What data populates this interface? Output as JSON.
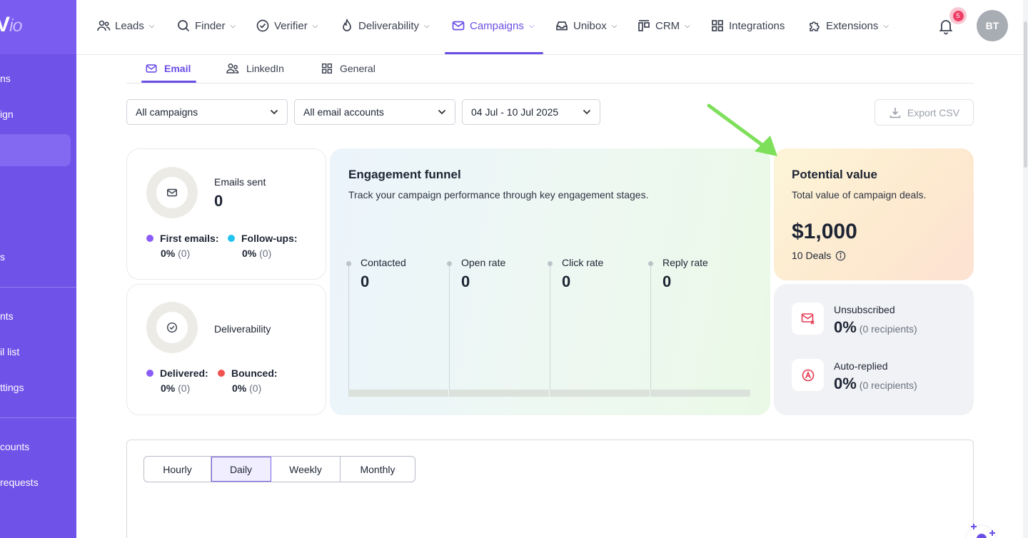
{
  "sidebar": {
    "logo_main": "V",
    "logo_suffix": "io",
    "items": [
      "ns",
      "ign",
      "s",
      "nts",
      "il list",
      "ttings",
      "counts",
      "requests"
    ]
  },
  "nav": {
    "items": [
      {
        "label": "Leads",
        "icon": "users-icon"
      },
      {
        "label": "Finder",
        "icon": "search-icon"
      },
      {
        "label": "Verifier",
        "icon": "check-circle-icon"
      },
      {
        "label": "Deliverability",
        "icon": "flame-icon"
      },
      {
        "label": "Campaigns",
        "icon": "mail-icon",
        "active": true
      },
      {
        "label": "Unibox",
        "icon": "inbox-icon"
      },
      {
        "label": "CRM",
        "icon": "crm-icon"
      },
      {
        "label": "Integrations",
        "icon": "grid-icon"
      },
      {
        "label": "Extensions",
        "icon": "puzzle-icon"
      }
    ],
    "notification_count": "5",
    "avatar_initials": "BT"
  },
  "subtabs": {
    "email": "Email",
    "linkedin": "LinkedIn",
    "general": "General"
  },
  "filters": {
    "campaigns": "All campaigns",
    "accounts": "All email accounts",
    "date_range": "04 Jul - 10 Jul 2025",
    "export": "Export CSV"
  },
  "emails_sent": {
    "label": "Emails sent",
    "value": "0",
    "first_label": "First emails:",
    "first_pct": "0%",
    "first_count": "(0)",
    "followup_label": "Follow-ups:",
    "followup_pct": "0%",
    "followup_count": "(0)"
  },
  "deliverability": {
    "label": "Deliverability",
    "delivered_label": "Delivered:",
    "delivered_pct": "0%",
    "delivered_count": "(0)",
    "bounced_label": "Bounced:",
    "bounced_pct": "0%",
    "bounced_count": "(0)"
  },
  "funnel": {
    "title": "Engagement funnel",
    "subtitle": "Track your campaign performance through key engagement stages.",
    "stages": [
      {
        "label": "Contacted",
        "value": "0"
      },
      {
        "label": "Open rate",
        "value": "0"
      },
      {
        "label": "Click rate",
        "value": "0"
      },
      {
        "label": "Reply rate",
        "value": "0"
      }
    ]
  },
  "potential_value": {
    "title": "Potential value",
    "subtitle": "Total value of campaign deals.",
    "amount": "$1,000",
    "deals": "10 Deals"
  },
  "stats": {
    "unsubscribed_label": "Unsubscribed",
    "unsubscribed_value": "0%",
    "unsubscribed_note": "(0 recipients)",
    "autoreplied_label": "Auto-replied",
    "autoreplied_value": "0%",
    "autoreplied_note": "(0 recipients)"
  },
  "granularity": {
    "options": [
      "Hourly",
      "Daily",
      "Weekly",
      "Monthly"
    ],
    "selected": "Daily"
  },
  "colors": {
    "accent": "#6b4ee6",
    "first_emails": "#8b5cf6",
    "followups": "#22c3ee",
    "delivered": "#8b5cf6",
    "bounced": "#ef5350",
    "annotation_arrow": "#7ee05a"
  }
}
